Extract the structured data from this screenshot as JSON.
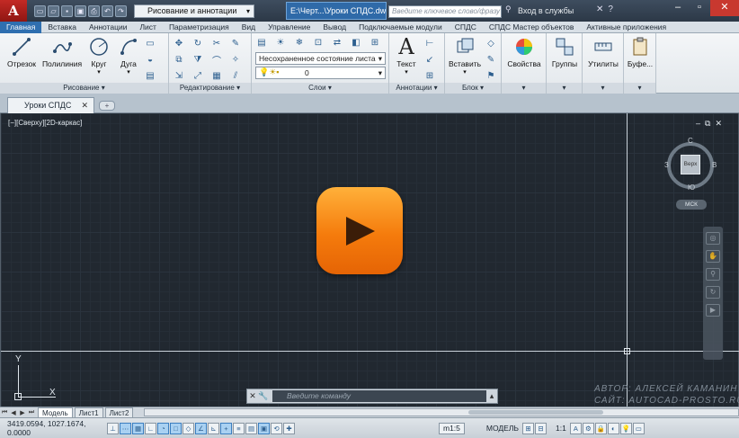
{
  "title": {
    "app_logo": "A",
    "workspace": "Рисование и аннотации",
    "document": "E:\\Черт...\\Уроки СПДС.dwg",
    "search_placeholder": "Введите ключевое слово/фразу",
    "login": "Вход в службы"
  },
  "ribbon_tabs": [
    "Главная",
    "Вставка",
    "Аннотации",
    "Лист",
    "Параметризация",
    "Вид",
    "Управление",
    "Вывод",
    "Подключаемые модули",
    "СПДС",
    "СПДС Мастер объектов",
    "Активные приложения"
  ],
  "ribbon": {
    "draw": {
      "title": "Рисование",
      "line": "Отрезок",
      "polyline": "Полилиния",
      "circle": "Круг",
      "arc": "Дуга"
    },
    "modify": {
      "title": "Редактирование"
    },
    "layers": {
      "title": "Слои",
      "state": "Несохраненное состояние листа",
      "current": "0"
    },
    "annotation": {
      "title": "Аннотации",
      "text": "Текст"
    },
    "block": {
      "title": "Блок",
      "insert": "Вставить"
    },
    "properties": "Свойства",
    "groups": "Группы",
    "utilities": "Утилиты",
    "clipboard": "Буфе..."
  },
  "doc_tab": "Уроки СПДС",
  "viewport": {
    "label": "[−][Сверху][2D-каркас]",
    "viewcube": {
      "face": "Верх",
      "n": "С",
      "s": "Ю",
      "w": "З",
      "e": "В"
    },
    "wcs": "МСК"
  },
  "watermark": [
    "АВТОР: АЛЕКСЕЙ КАМАНИН",
    "САЙТ: AUTOCAD-PROSTO.RU"
  ],
  "ucs": {
    "x": "X",
    "y": "Y"
  },
  "command": {
    "placeholder": "Введите команду"
  },
  "layout_tabs": [
    "Модель",
    "Лист1",
    "Лист2"
  ],
  "status": {
    "coords": "3419.0594, 1027.1674, 0.0000",
    "scale": "m1:5",
    "model": "МОДЕЛЬ",
    "annot_scale": "1:1"
  },
  "colors": {
    "accent": "#2f6fb0",
    "play": "#f57b0c",
    "canvas": "#212830"
  }
}
